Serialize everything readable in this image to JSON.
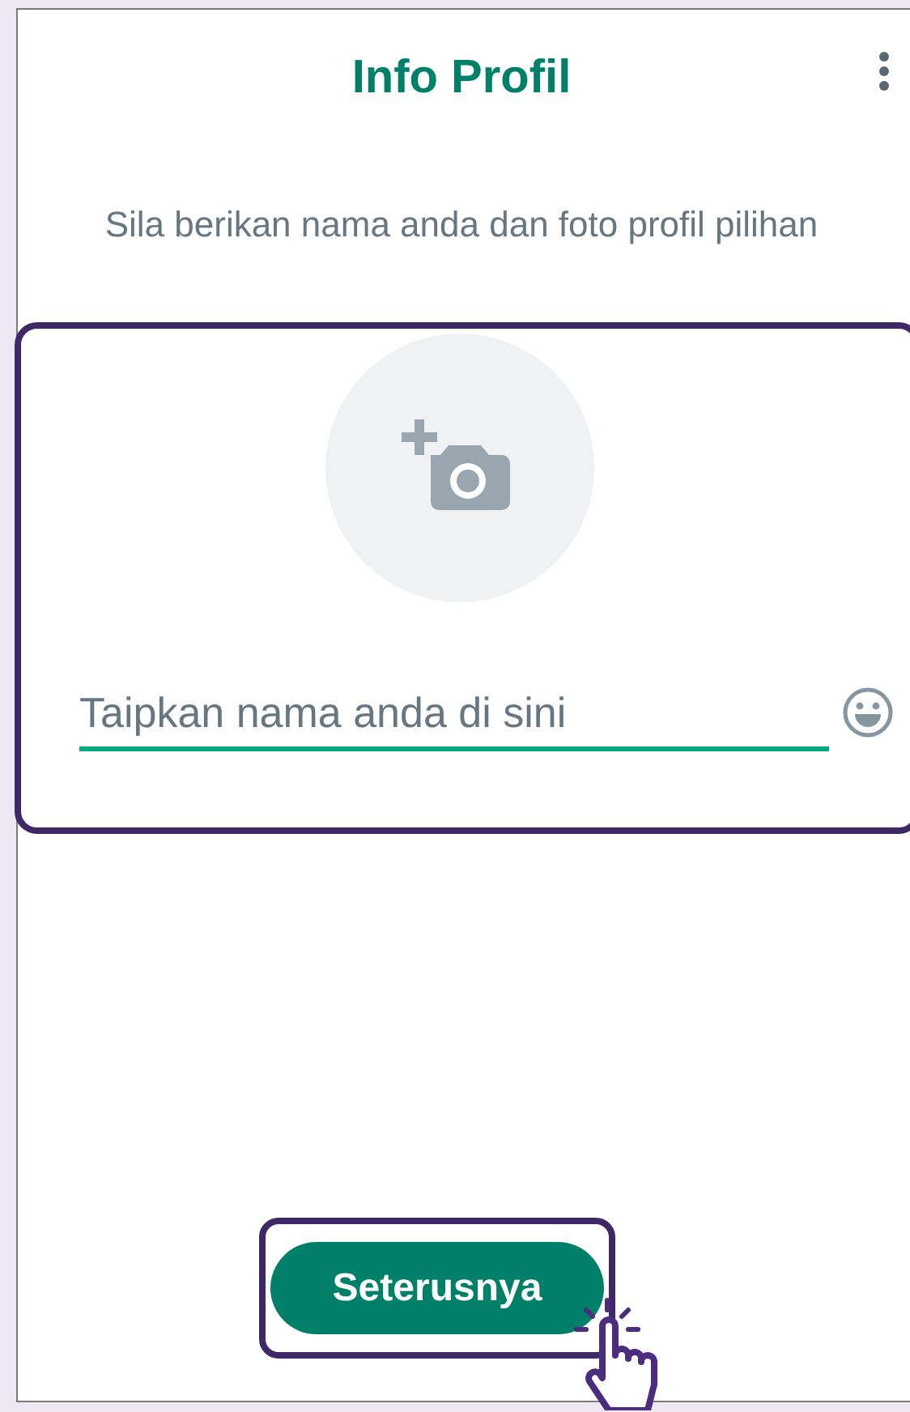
{
  "header": {
    "title": "Info Profil"
  },
  "subtitle": "Sila berikan nama anda dan foto profil pilihan",
  "name_field": {
    "placeholder": "Taipkan nama anda di sini"
  },
  "next_button": {
    "label": "Seterusnya"
  }
}
